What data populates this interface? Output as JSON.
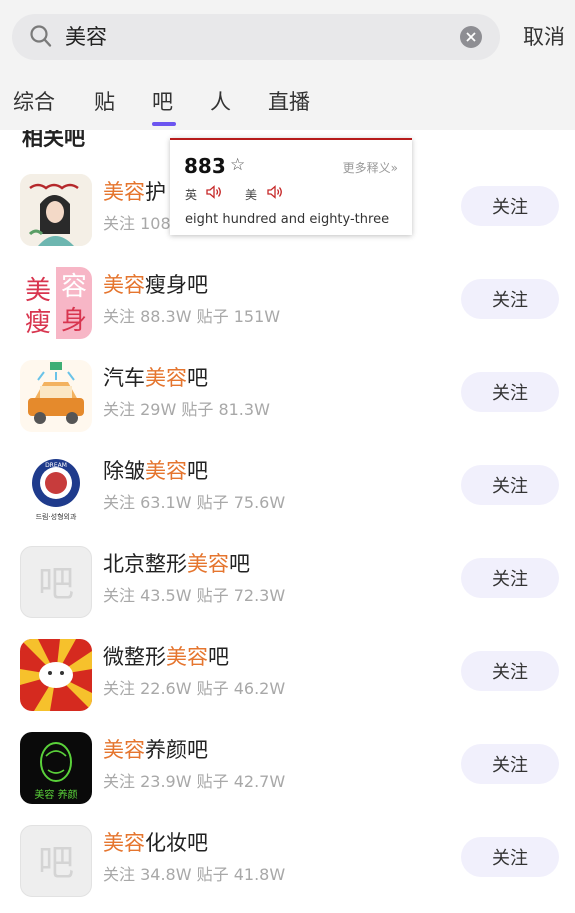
{
  "search": {
    "query": "美容"
  },
  "header": {
    "cancel_label": "取消"
  },
  "tabs": [
    {
      "label": "综合"
    },
    {
      "label": "贴"
    },
    {
      "label": "吧",
      "active": true
    },
    {
      "label": "人"
    },
    {
      "label": "直播"
    }
  ],
  "section": {
    "title": "相关吧"
  },
  "bars": [
    {
      "name_hl": "美容",
      "name_rest": "护",
      "stats": "关注 108"
    },
    {
      "name_hl": "美容",
      "name_rest": "瘦身吧",
      "stats": "关注 88.3W 贴子 151W"
    },
    {
      "name_pre": "汽车",
      "name_hl": "美容",
      "name_rest": "吧",
      "stats": "关注 29W 贴子 81.3W"
    },
    {
      "name_pre": "除皱",
      "name_hl": "美容",
      "name_rest": "吧",
      "stats": "关注 63.1W 贴子 75.6W"
    },
    {
      "name_pre": "北京整形",
      "name_hl": "美容",
      "name_rest": "吧",
      "stats": "关注 43.5W 贴子 72.3W"
    },
    {
      "name_pre": "微整形",
      "name_hl": "美容",
      "name_rest": "吧",
      "stats": "关注 22.6W 贴子 46.2W"
    },
    {
      "name_hl": "美容",
      "name_rest": "养颜吧",
      "stats": "关注 23.9W 贴子 42.7W"
    },
    {
      "name_hl": "美容",
      "name_rest": "化妆吧",
      "stats": "关注 34.8W 贴子 41.8W"
    }
  ],
  "follow_label": "关注",
  "avatar_text": {
    "slim_1": "美",
    "slim_2": "容",
    "slim_3": "瘦",
    "slim_4": "身",
    "placeholder": "吧",
    "dream_top": "DREAM",
    "dream_bottom": "드림·성형외과",
    "skin_label": "美容  养颜"
  },
  "popup": {
    "word": "883",
    "more": "更多释义»",
    "uk_label": "英",
    "us_label": "美",
    "definition": "eight hundred and eighty-three"
  },
  "colors": {
    "highlight": "#e5752e",
    "accent": "#6c55f0",
    "popup_border": "#b71c1c"
  }
}
